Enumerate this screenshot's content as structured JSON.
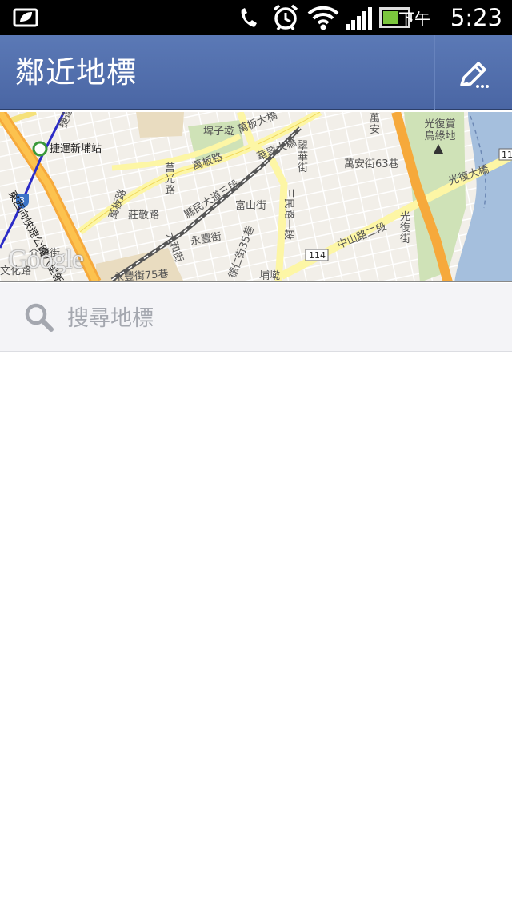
{
  "status_bar": {
    "ampm": "下午",
    "time": "5:23",
    "battery_level": 0.6,
    "icons": [
      "notification-icon",
      "phone-icon",
      "alarm-icon",
      "wifi-icon",
      "signal-icon",
      "battery-icon"
    ]
  },
  "header": {
    "title": "鄰近地標",
    "edit_icon": "edit-pencil-icon",
    "bar_color": "#5470ad"
  },
  "map": {
    "labels": {
      "station": "捷運新埔站",
      "road_wanban": "萬板路",
      "road_wanban_bridge": "萬板大橋",
      "road_huacui": "華翠大橋",
      "road_xianmin": "縣民大道三段",
      "road_fushan": "富山街",
      "road_zhuangjing": "莊敬路",
      "road_yongfeng": "永豐街",
      "road_minsheng": "三民路一段",
      "road_zhongshan": "中山路二段",
      "road_wanan": "萬安街63巷",
      "road_guangfu_bridge": "光復大橋",
      "park": "光復賞鳥綠地",
      "route_114": "114",
      "route_3": "3",
      "route_11": "11",
      "district": "埤子墘",
      "road_jieyun": "捷運",
      "road_cuihua": "翠華街",
      "road_qianguang": "莒光路",
      "road_dahe": "大和街",
      "road_putang": "埔墘",
      "road_wanan2": "萬安",
      "road_guangfu": "光復街",
      "road_yongfeng75": "永豐街75巷",
      "road_deren": "德仁街35巷",
      "road_jiezhou": "介壽街",
      "road_wenhua": "文化路",
      "road_wanban2": "萬板路",
      "expressway": "東西向快速公路八里新店線"
    },
    "google_logo": "Google"
  },
  "search": {
    "placeholder": "搜尋地標",
    "value": ""
  }
}
